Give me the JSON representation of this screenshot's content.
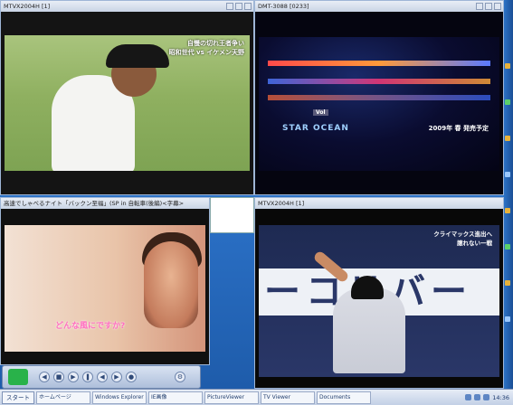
{
  "windows": [
    {
      "title": "MTVX2004H [1]",
      "caption_line1": "自慢の切れ王者争い",
      "caption_line2": "昭和世代 vs イケメン天野"
    },
    {
      "title": "DMT-3088 [0233]",
      "hud_text": "STAR OCEAN",
      "vol_label": "Vol",
      "release_text": "2009年 春 発売予定"
    },
    {
      "title": "高速でしゃべるナイト「バックン至福」(SP in 自転車(後編)<字幕>",
      "caption": "どんな風にですか?"
    },
    {
      "title": "MTVX2004H [1]",
      "corner_caption_line1": "クライマックス進出へ",
      "corner_caption_line2": "譲れない一戦",
      "sign_text": "ーコリバー"
    }
  ],
  "taskbar": {
    "start_label": "スタート",
    "items": [
      "ホームページ",
      "Windows Explorer",
      "IE画像",
      "PictureViewer",
      "TV Viewer",
      "Documents"
    ],
    "clock": "14:36"
  },
  "colors": {
    "desktop": "#2a6fc4",
    "taskbar": "#c3d0e6",
    "caption_pink": "#ff6fc0"
  }
}
